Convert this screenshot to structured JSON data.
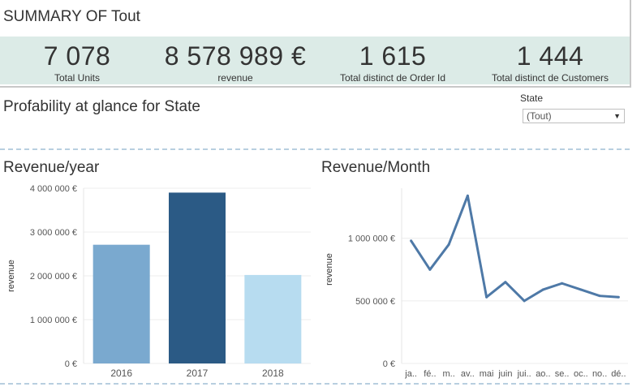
{
  "summary": {
    "title": "SUMMARY OF Tout",
    "kpis": [
      {
        "value": "7 078",
        "label": "Total Units"
      },
      {
        "value": "8 578 989 €",
        "label": "revenue"
      },
      {
        "value": "1 615",
        "label": "Total distinct de Order Id"
      },
      {
        "value": "1 444",
        "label": "Total distinct de Customers"
      }
    ]
  },
  "section": {
    "title": "Profability at glance for State"
  },
  "filter": {
    "label": "State",
    "selected": "(Tout)"
  },
  "colors": {
    "kpi_band": "#dcebe7",
    "line": "#4e79a7",
    "bar_2016": "#7aa9cf",
    "bar_2017": "#2b5a85",
    "bar_2018": "#b7dcf0"
  },
  "chart_data": [
    {
      "type": "bar",
      "title": "Revenue/year",
      "ylabel": "revenue",
      "categories": [
        "2016",
        "2017",
        "2018"
      ],
      "values": [
        2710000,
        3900000,
        2020000
      ],
      "ylim": [
        0,
        4000000
      ],
      "yticks": [
        0,
        1000000,
        2000000,
        3000000,
        4000000
      ],
      "ytick_labels": [
        "0 €",
        "1 000 000 €",
        "2 000 000 €",
        "3 000 000 €",
        "4 000 000 €"
      ],
      "grid": true
    },
    {
      "type": "line",
      "title": "Revenue/Month",
      "ylabel": "revenue",
      "categories": [
        "ja..",
        "fé..",
        "m..",
        "av..",
        "mai",
        "juin",
        "jui..",
        "ao..",
        "se..",
        "oc..",
        "no..",
        "dé.."
      ],
      "values": [
        980000,
        750000,
        950000,
        1340000,
        530000,
        650000,
        500000,
        590000,
        640000,
        590000,
        540000,
        530000
      ],
      "yticks": [
        0,
        500000,
        1000000
      ],
      "ytick_labels": [
        "0 €",
        "500 000 €",
        "1 000 000 €"
      ],
      "grid": true
    }
  ]
}
